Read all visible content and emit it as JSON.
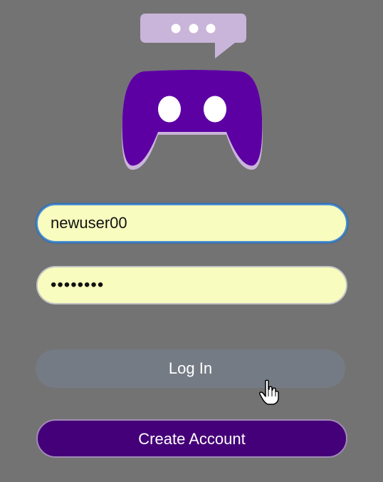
{
  "app": {
    "logo_icon": "game-controller-chat-icon",
    "colors": {
      "background": "#737373",
      "brand_purple": "#5c00a3",
      "chat_bubble": "#c9b5d9",
      "input_fill": "#f8fcbe",
      "login_button": "#757b84",
      "create_button": "#440078"
    }
  },
  "form": {
    "username_value": "newuser00",
    "password_value": "••••••••",
    "login_label": "Log In",
    "create_account_label": "Create Account"
  },
  "cursor": {
    "icon": "hand-pointer-icon"
  }
}
